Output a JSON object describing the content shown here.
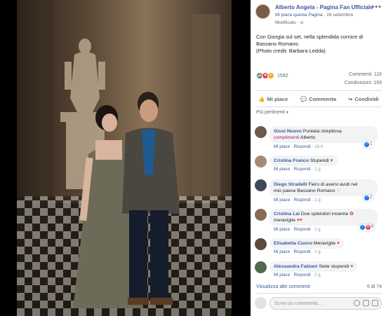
{
  "post": {
    "page_name": "Alberto Angela - Pagina Fan Ufficiale",
    "liked_by": "Mi piace questa Pagina",
    "date": "28 settembre",
    "edited": "Modificato",
    "caption_lines": [
      "Con Giorgia sul set, nella splendida cornice di",
      "Bassano Romano.",
      "(Photo credit: Barbara Ledda)"
    ]
  },
  "stats": {
    "reactions": "1592",
    "comments": "Commenti: 116",
    "shares": "Condivisioni: 169"
  },
  "actions": {
    "like": "Mi piace",
    "comment": "Commenta",
    "share": "Condividi"
  },
  "sort_label": "Più pertinenti",
  "comment_labels": {
    "like": "Mi piace",
    "reply": "Rispondi"
  },
  "comments": [
    {
      "author": "Giusi Nuovo",
      "text": "Puntata strepitosa",
      "tag": "complimenti",
      "text2": "Alberto",
      "time": "18 h",
      "reacts": "1"
    },
    {
      "author": "Cristina Franco",
      "text": "Stupendi",
      "time": "1 g"
    },
    {
      "author": "Diego Stradelli",
      "text": "Fiero di avervi avuti nel",
      "text2": "mio paese Bassano Romano",
      "time": "1 g",
      "reacts": "2"
    },
    {
      "author": "Cristina Lai",
      "text": "Due splendori insieme",
      "text2": "meraviglie",
      "time": "1 g",
      "reacts": "6"
    },
    {
      "author": "Elisabetta Cuoco",
      "text": "Meraviglie",
      "time": "1 g"
    },
    {
      "author": "Alessandra Fabiani",
      "text": "Siete stupendi",
      "time": "1 g"
    }
  ],
  "footer": {
    "more_comments": "Visualizza altri commenti",
    "count": "6 di 74",
    "input_placeholder": "Scrivi un commento..."
  },
  "colors": {
    "link": "#385898",
    "like": "#1877f2",
    "love": "#f33e58"
  }
}
